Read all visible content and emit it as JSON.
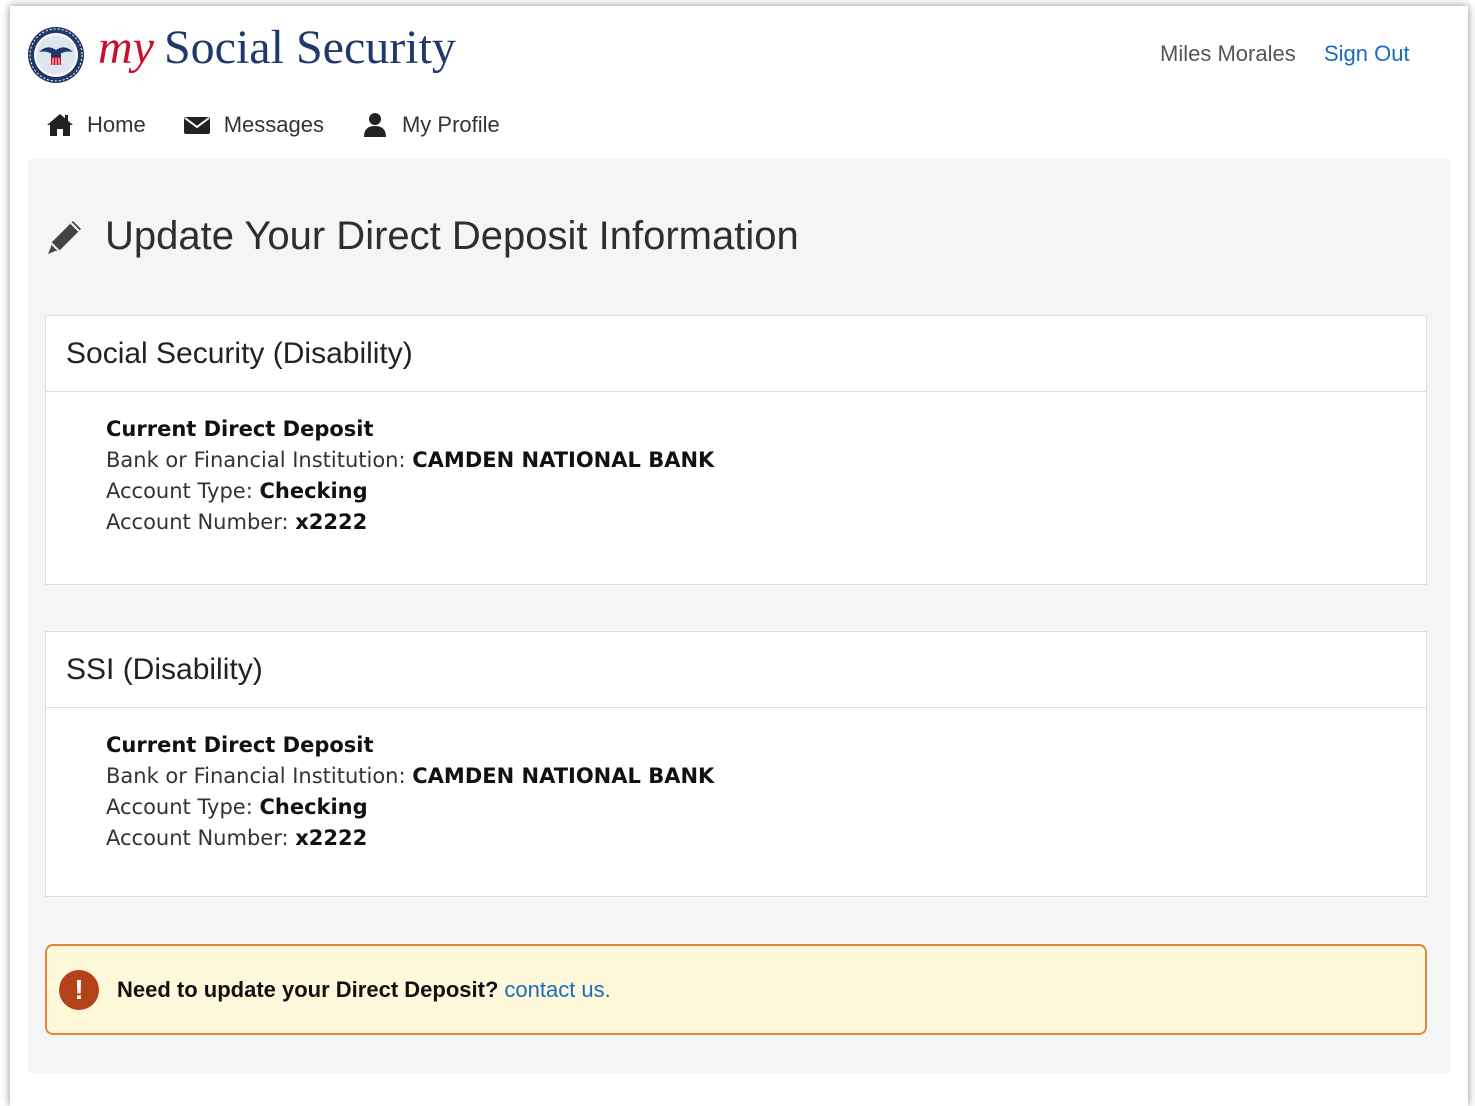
{
  "header": {
    "brand_my": "my",
    "brand_name": "Social Security",
    "user_name": "Miles Morales",
    "sign_out": "Sign Out"
  },
  "nav": {
    "items": [
      {
        "label": "Home",
        "icon": "home-icon"
      },
      {
        "label": "Messages",
        "icon": "envelope-icon"
      },
      {
        "label": "My Profile",
        "icon": "user-icon"
      }
    ]
  },
  "page": {
    "title": "Update Your Direct Deposit Information",
    "title_icon": "pencil-icon"
  },
  "cards": [
    {
      "title": "Social Security (Disability)",
      "section_heading": "Current Direct Deposit",
      "bank_label": "Bank or Financial Institution:",
      "bank_value": "CAMDEN NATIONAL BANK",
      "type_label": "Account Type:",
      "type_value": "Checking",
      "number_label": "Account Number:",
      "number_value": "x2222"
    },
    {
      "title": "SSI (Disability)",
      "section_heading": "Current Direct Deposit",
      "bank_label": "Bank or Financial Institution:",
      "bank_value": "CAMDEN NATIONAL BANK",
      "type_label": "Account Type:",
      "type_value": "Checking",
      "number_label": "Account Number:",
      "number_value": "x2222"
    }
  ],
  "alert": {
    "icon": "!",
    "text": "Need to update your Direct Deposit?",
    "link": "contact us."
  },
  "colors": {
    "brand_red": "#c8102e",
    "brand_navy": "#1f3a68",
    "link_blue": "#1a6cc0",
    "alert_border": "#e0883b",
    "alert_bg": "#fdf8d9"
  }
}
